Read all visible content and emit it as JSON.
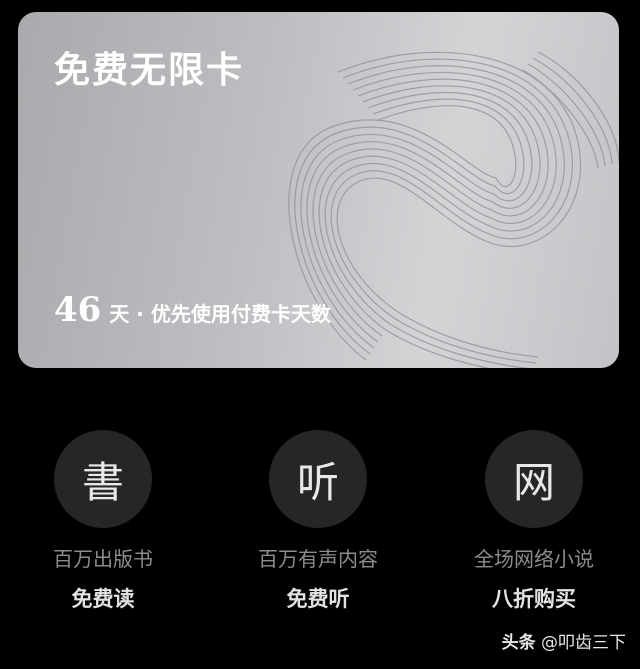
{
  "card": {
    "title": "免费无限卡",
    "days_value": "46",
    "days_text": "天 · 优先使用付费卡天数"
  },
  "features": [
    {
      "glyph": "書",
      "subtitle": "百万出版书",
      "title": "免费读"
    },
    {
      "glyph": "听",
      "subtitle": "百万有声内容",
      "title": "免费听"
    },
    {
      "glyph": "网",
      "subtitle": "全场网络小说",
      "title": "八折购买"
    }
  ],
  "watermark": {
    "brand": "头条",
    "handle": "@叩齿三下"
  }
}
